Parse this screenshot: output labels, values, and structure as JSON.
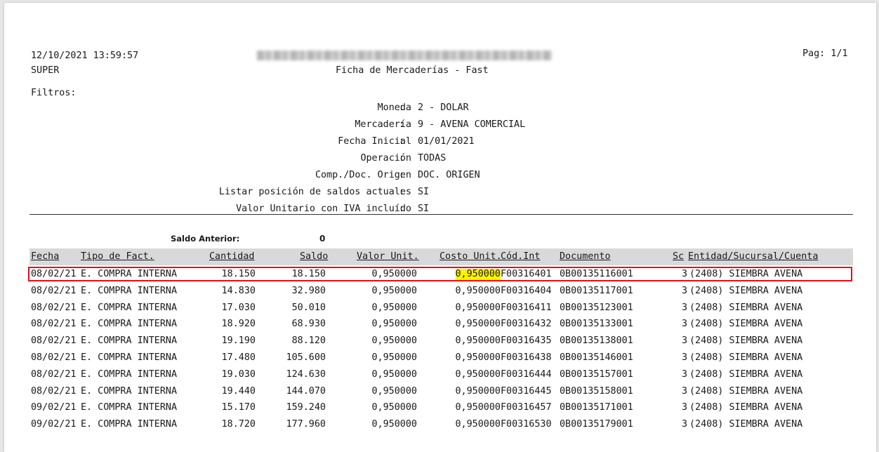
{
  "header": {
    "datetime": "12/10/2021 13:59:57",
    "user": "SUPER",
    "report_title": "Ficha de Mercaderías - Fast",
    "page_label": "Pag: 1/1",
    "filters_label": "Filtros:"
  },
  "filters": [
    {
      "label": "Moneda",
      "value": "2 - DOLAR"
    },
    {
      "label": "Mercadería",
      "value": "9 - AVENA COMERCIAL"
    },
    {
      "label": "Fecha Inicial",
      "value": "01/01/2021"
    },
    {
      "label": "Operación",
      "value": "TODAS"
    },
    {
      "label": "Comp./Doc. Origen",
      "value": "DOC. ORIGEN"
    },
    {
      "label": "Listar posición de saldos actuales",
      "value": "SI"
    },
    {
      "label": "Valor Unitario con IVA incluído",
      "value": "SI"
    }
  ],
  "saldo_anterior": {
    "label": "Saldo Anterior:",
    "value": "0"
  },
  "table": {
    "columns": [
      "Fecha",
      "Tipo de Fact.",
      "Cantidad",
      "Saldo",
      "Valor Unit.",
      "Costo Unit.",
      "Cód.Int",
      "Documento",
      "Sc",
      "Entidad/Sucursal/Cuenta"
    ],
    "rows": [
      {
        "fecha": "08/02/21",
        "tipo": "E. COMPRA INTERNA",
        "cantidad": "18.150",
        "saldo": "18.150",
        "valor_unit": "0,950000",
        "costo_unit": "0,950000",
        "cod_int": "F00316401",
        "documento": "0B00135116001",
        "sc": "3",
        "entidad": "(2408) SIEMBRA AVENA",
        "highlighted": true
      },
      {
        "fecha": "08/02/21",
        "tipo": "E. COMPRA INTERNA",
        "cantidad": "14.830",
        "saldo": "32.980",
        "valor_unit": "0,950000",
        "costo_unit": "0,950000",
        "cod_int": "F00316404",
        "documento": "0B00135117001",
        "sc": "3",
        "entidad": "(2408) SIEMBRA AVENA",
        "highlighted": false
      },
      {
        "fecha": "08/02/21",
        "tipo": "E. COMPRA INTERNA",
        "cantidad": "17.030",
        "saldo": "50.010",
        "valor_unit": "0,950000",
        "costo_unit": "0,950000",
        "cod_int": "F00316411",
        "documento": "0B00135123001",
        "sc": "3",
        "entidad": "(2408) SIEMBRA AVENA",
        "highlighted": false
      },
      {
        "fecha": "08/02/21",
        "tipo": "E. COMPRA INTERNA",
        "cantidad": "18.920",
        "saldo": "68.930",
        "valor_unit": "0,950000",
        "costo_unit": "0,950000",
        "cod_int": "F00316432",
        "documento": "0B00135133001",
        "sc": "3",
        "entidad": "(2408) SIEMBRA AVENA",
        "highlighted": false
      },
      {
        "fecha": "08/02/21",
        "tipo": "E. COMPRA INTERNA",
        "cantidad": "19.190",
        "saldo": "88.120",
        "valor_unit": "0,950000",
        "costo_unit": "0,950000",
        "cod_int": "F00316435",
        "documento": "0B00135138001",
        "sc": "3",
        "entidad": "(2408) SIEMBRA AVENA",
        "highlighted": false
      },
      {
        "fecha": "08/02/21",
        "tipo": "E. COMPRA INTERNA",
        "cantidad": "17.480",
        "saldo": "105.600",
        "valor_unit": "0,950000",
        "costo_unit": "0,950000",
        "cod_int": "F00316438",
        "documento": "0B00135146001",
        "sc": "3",
        "entidad": "(2408) SIEMBRA AVENA",
        "highlighted": false
      },
      {
        "fecha": "08/02/21",
        "tipo": "E. COMPRA INTERNA",
        "cantidad": "19.030",
        "saldo": "124.630",
        "valor_unit": "0,950000",
        "costo_unit": "0,950000",
        "cod_int": "F00316444",
        "documento": "0B00135157001",
        "sc": "3",
        "entidad": "(2408) SIEMBRA AVENA",
        "highlighted": false
      },
      {
        "fecha": "08/02/21",
        "tipo": "E. COMPRA INTERNA",
        "cantidad": "19.440",
        "saldo": "144.070",
        "valor_unit": "0,950000",
        "costo_unit": "0,950000",
        "cod_int": "F00316445",
        "documento": "0B00135158001",
        "sc": "3",
        "entidad": "(2408) SIEMBRA AVENA",
        "highlighted": false
      },
      {
        "fecha": "09/02/21",
        "tipo": "E. COMPRA INTERNA",
        "cantidad": "15.170",
        "saldo": "159.240",
        "valor_unit": "0,950000",
        "costo_unit": "0,950000",
        "cod_int": "F00316457",
        "documento": "0B00135171001",
        "sc": "3",
        "entidad": "(2408) SIEMBRA AVENA",
        "highlighted": false
      },
      {
        "fecha": "09/02/21",
        "tipo": "E. COMPRA INTERNA",
        "cantidad": "18.720",
        "saldo": "177.960",
        "valor_unit": "0,950000",
        "costo_unit": "0,950000",
        "cod_int": "F00316530",
        "documento": "0B00135179001",
        "sc": "3",
        "entidad": "(2408) SIEMBRA AVENA",
        "highlighted": false
      }
    ]
  },
  "colors": {
    "highlight": "#fff200",
    "selection_border": "#e0101a",
    "header_bg": "#d9d9d9"
  }
}
